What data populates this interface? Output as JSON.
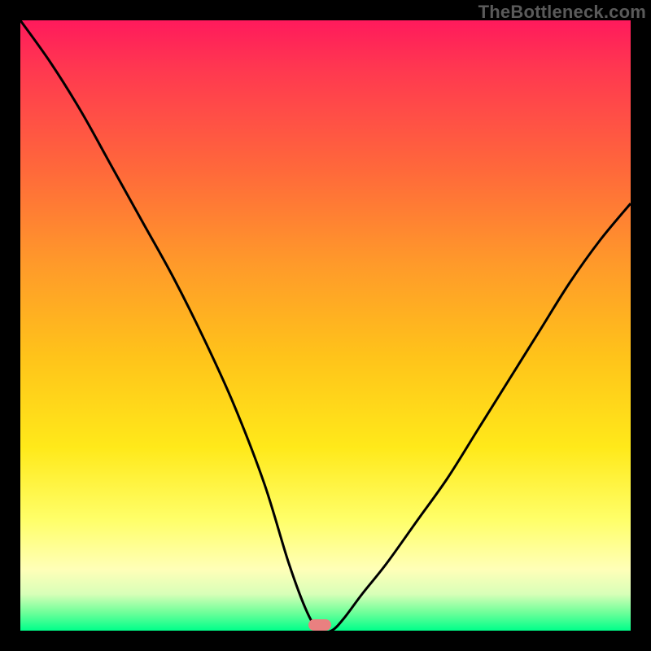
{
  "watermark": "TheBottleneck.com",
  "marker": {
    "x_pct": 49,
    "y_pct": 99
  },
  "chart_data": {
    "type": "line",
    "title": "",
    "xlabel": "",
    "ylabel": "",
    "xlim": [
      0,
      100
    ],
    "ylim": [
      0,
      100
    ],
    "grid": false,
    "series": [
      {
        "name": "bottleneck-curve",
        "x": [
          0,
          5,
          10,
          15,
          20,
          25,
          30,
          35,
          40,
          44,
          47,
          49,
          51,
          53,
          56,
          60,
          65,
          70,
          75,
          80,
          85,
          90,
          95,
          100
        ],
        "y": [
          100,
          93,
          85,
          76,
          67,
          58,
          48,
          37,
          24,
          11,
          3,
          0,
          0,
          2,
          6,
          11,
          18,
          25,
          33,
          41,
          49,
          57,
          64,
          70
        ]
      }
    ],
    "annotations": [
      {
        "text": "TheBottleneck.com",
        "position": "top-right"
      }
    ]
  },
  "gradient_stops": [
    {
      "pct": 0,
      "color": "#ff1a5c"
    },
    {
      "pct": 25,
      "color": "#ff6a3a"
    },
    {
      "pct": 55,
      "color": "#ffc31a"
    },
    {
      "pct": 82,
      "color": "#ffff6a"
    },
    {
      "pct": 100,
      "color": "#00ff8a"
    }
  ]
}
